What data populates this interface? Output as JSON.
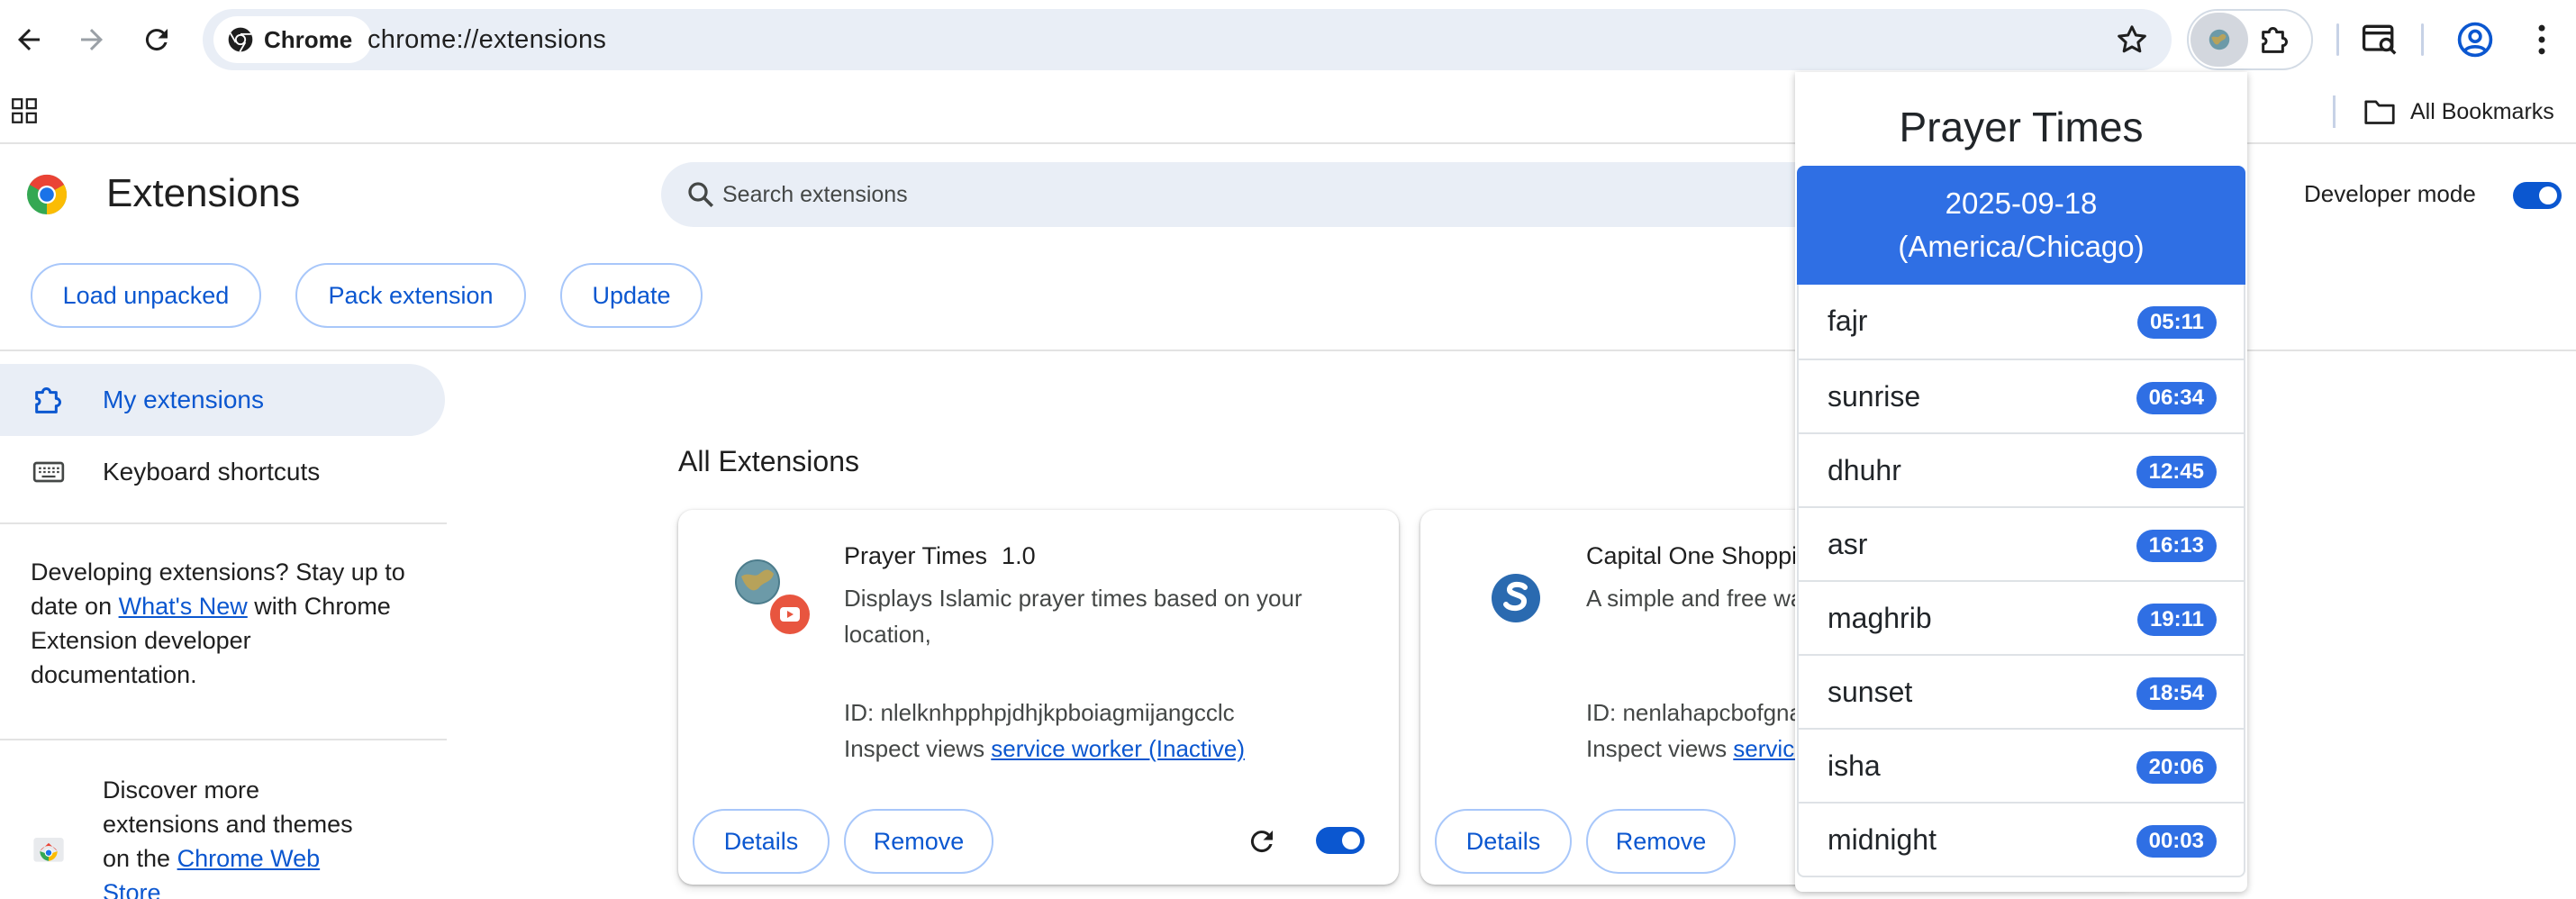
{
  "browser": {
    "chip_label": "Chrome",
    "url": "chrome://extensions",
    "bookmarks_label": "All Bookmarks"
  },
  "header": {
    "title": "Extensions",
    "search_placeholder": "Search extensions",
    "developer_mode_label": "Developer mode",
    "developer_mode_on": true,
    "buttons": {
      "load_unpacked": "Load unpacked",
      "pack_extension": "Pack extension",
      "update": "Update"
    }
  },
  "sidebar": {
    "items": [
      {
        "label": "My extensions",
        "icon": "extension-icon",
        "active": true
      },
      {
        "label": "Keyboard shortcuts",
        "icon": "keyboard-icon",
        "active": false
      }
    ],
    "dev_text_before": "Developing extensions? Stay up to date on ",
    "dev_link": "What's New",
    "dev_text_after": " with Chrome Extension developer documentation.",
    "store_text_before": "Discover more extensions and themes on the ",
    "store_link": "Chrome Web Store"
  },
  "main": {
    "section_title": "All Extensions",
    "cards": [
      {
        "name": "Prayer Times",
        "version": "1.0",
        "description": "Displays Islamic prayer times based on your location,",
        "id_label": "ID: nlelknhpphpjdhjkpboiagmijangcclc",
        "inspect_prefix": "Inspect views ",
        "inspect_link": "service worker (Inactive)",
        "details_label": "Details",
        "remove_label": "Remove",
        "enabled": true
      },
      {
        "name": "Capital One Shopping",
        "description": "A simple and free way to",
        "id_label": "ID: nenlahapcbofgnanklpelkaejcehkggg",
        "inspect_prefix": "Inspect views ",
        "inspect_link": "service worker",
        "details_label": "Details",
        "remove_label": "Remove"
      }
    ]
  },
  "popup": {
    "title": "Prayer Times",
    "date": "2025-09-18",
    "timezone": "(America/Chicago)",
    "accent_color": "#2f6fe4",
    "prayers": [
      {
        "name": "fajr",
        "time": "05:11"
      },
      {
        "name": "sunrise",
        "time": "06:34"
      },
      {
        "name": "dhuhr",
        "time": "12:45"
      },
      {
        "name": "asr",
        "time": "16:13"
      },
      {
        "name": "maghrib",
        "time": "19:11"
      },
      {
        "name": "sunset",
        "time": "18:54"
      },
      {
        "name": "isha",
        "time": "20:06"
      },
      {
        "name": "midnight",
        "time": "00:03"
      }
    ]
  }
}
